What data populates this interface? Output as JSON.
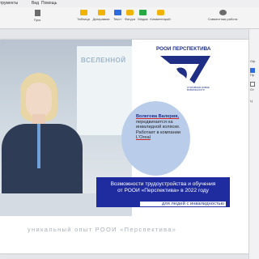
{
  "menubar": {
    "items": [
      "трументы",
      "Вид",
      "Помощь"
    ]
  },
  "toolbar": {
    "buttons": [
      {
        "label": "Пуск",
        "icon": "play-icon",
        "color": "#6b6b6b"
      },
      {
        "label": "Таблица",
        "icon": "table-icon",
        "color": "#f0b400"
      },
      {
        "label": "Диаграмма",
        "icon": "chart-icon",
        "color": "#f0b400"
      },
      {
        "label": "Текст",
        "icon": "text-icon",
        "color": "#2f6bdc"
      },
      {
        "label": "Фигура",
        "icon": "shape-icon",
        "color": "#f0b400"
      },
      {
        "label": "Медиа",
        "icon": "media-icon",
        "color": "#27a844"
      },
      {
        "label": "Комментарий",
        "icon": "comment-icon",
        "color": "#f0b400"
      },
      {
        "label": "Совместная работа",
        "icon": "collaboration-icon",
        "color": "#6b6b6b"
      }
    ]
  },
  "slide": {
    "wall_text": "ВСЕЛЕННОЙ",
    "logo_title": "РООИ ПЕРСПЕКТИВА",
    "logo_sub": "ОТКРЫВАЕМ НОВЫЕ ВОЗМОЖНОСТИ",
    "bubble": {
      "name": "Волегова Валерия,",
      "line1": "передвигается на инвалидной коляске. Работает в компании",
      "company": "L'Oreal"
    },
    "banner": {
      "line1": "Возможности трудоустройства и обучения",
      "line2": "от РООИ «Перспектива» в 2022 году",
      "sub": "для людей с инвалидностью"
    },
    "footer": "уникальный опыт РООИ «Перспектива»"
  },
  "right_panel": {
    "labels": [
      "Оф",
      "Пр",
      "От",
      "Ц"
    ]
  }
}
